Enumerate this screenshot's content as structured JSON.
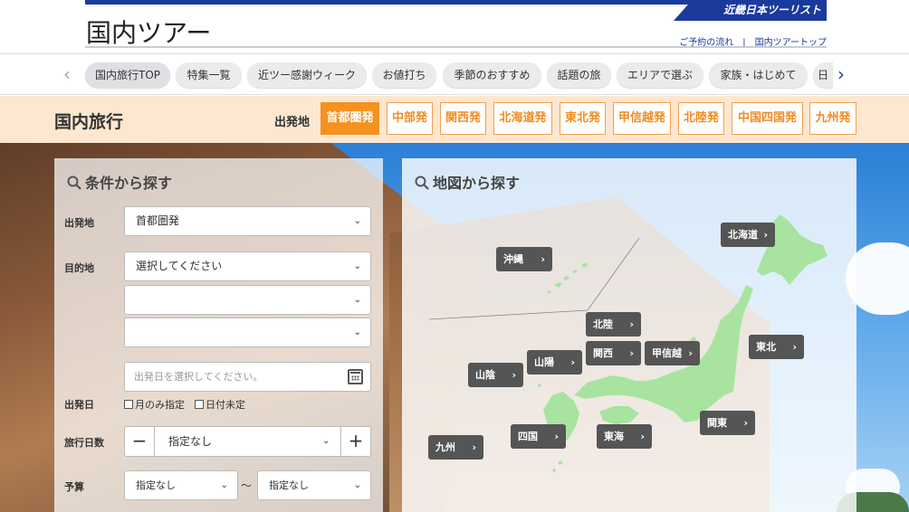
{
  "header": {
    "brand": "近畿日本ツーリスト",
    "title": "国内ツアー",
    "links": [
      "ご予約の流れ",
      "国内ツアートップ"
    ],
    "separator": "|"
  },
  "catnav": {
    "items": [
      "国内旅行TOP",
      "特集一覧",
      "近ツー感謝ウィーク",
      "お値打ち",
      "季節のおすすめ",
      "話題の旅",
      "エリアで選ぶ",
      "家族・はじめて",
      "日"
    ],
    "prev_glyph": "‹",
    "next_glyph": "›"
  },
  "departure": {
    "title": "国内旅行",
    "label": "出発地",
    "options": [
      "首都圏発",
      "中部発",
      "関西発",
      "北海道発",
      "東北発",
      "甲信越発",
      "北陸発",
      "中国四国発",
      "九州発"
    ],
    "selected": "首都圏発"
  },
  "search": {
    "title": "条件から探す",
    "departure_label": "出発地",
    "departure_value": "首都圏発",
    "destination_label": "目的地",
    "destination_value": "選択してください",
    "date_label": "出発日",
    "date_placeholder": "出発日を選択してください。",
    "check_month_only": "月のみ指定",
    "check_date_undecided": "日付未定",
    "days_label": "旅行日数",
    "days_value": "指定なし",
    "minus": "−",
    "plus": "+",
    "budget_label": "予算",
    "budget_min": "指定なし",
    "budget_max": "指定なし",
    "tilde": "～",
    "chevron": "⌄"
  },
  "map": {
    "title": "地図から探す",
    "land_color": "#a8e3a0",
    "regions": [
      "北海道",
      "沖縄",
      "北陸",
      "関西",
      "甲信越",
      "東北",
      "山陽",
      "山陰",
      "関東",
      "四国",
      "東海",
      "九州"
    ],
    "arrow": "›"
  },
  "colors": {
    "brand_blue": "#1a3a9c",
    "orange": "#f5921e",
    "peach": "#fde7d0",
    "region_btn": "#555555"
  }
}
